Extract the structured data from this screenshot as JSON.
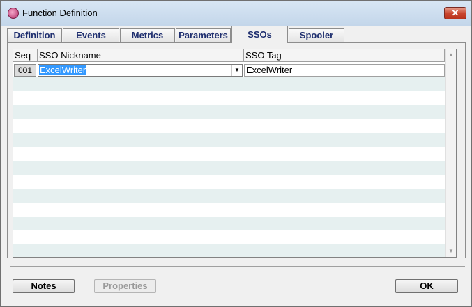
{
  "window": {
    "title": "Function Definition",
    "close_label": "✕"
  },
  "tabs": [
    {
      "label": "Definition"
    },
    {
      "label": "Events"
    },
    {
      "label": "Metrics"
    },
    {
      "label": "Parameters"
    },
    {
      "label": "SSOs",
      "active": true
    },
    {
      "label": "Spooler"
    }
  ],
  "grid": {
    "columns": {
      "seq": "Seq",
      "nickname": "SSO Nickname",
      "tag": "SSO Tag"
    },
    "rows": [
      {
        "seq": "001",
        "nickname": "ExcelWriter",
        "tag": "ExcelWriter"
      }
    ]
  },
  "buttons": {
    "notes": "Notes",
    "properties": "Properties",
    "ok": "OK"
  },
  "icons": {
    "app": "app-logo-icon",
    "dropdown": "dropdown-arrow-icon",
    "scroll_up": "scroll-up-icon",
    "scroll_down": "scroll-down-icon"
  }
}
